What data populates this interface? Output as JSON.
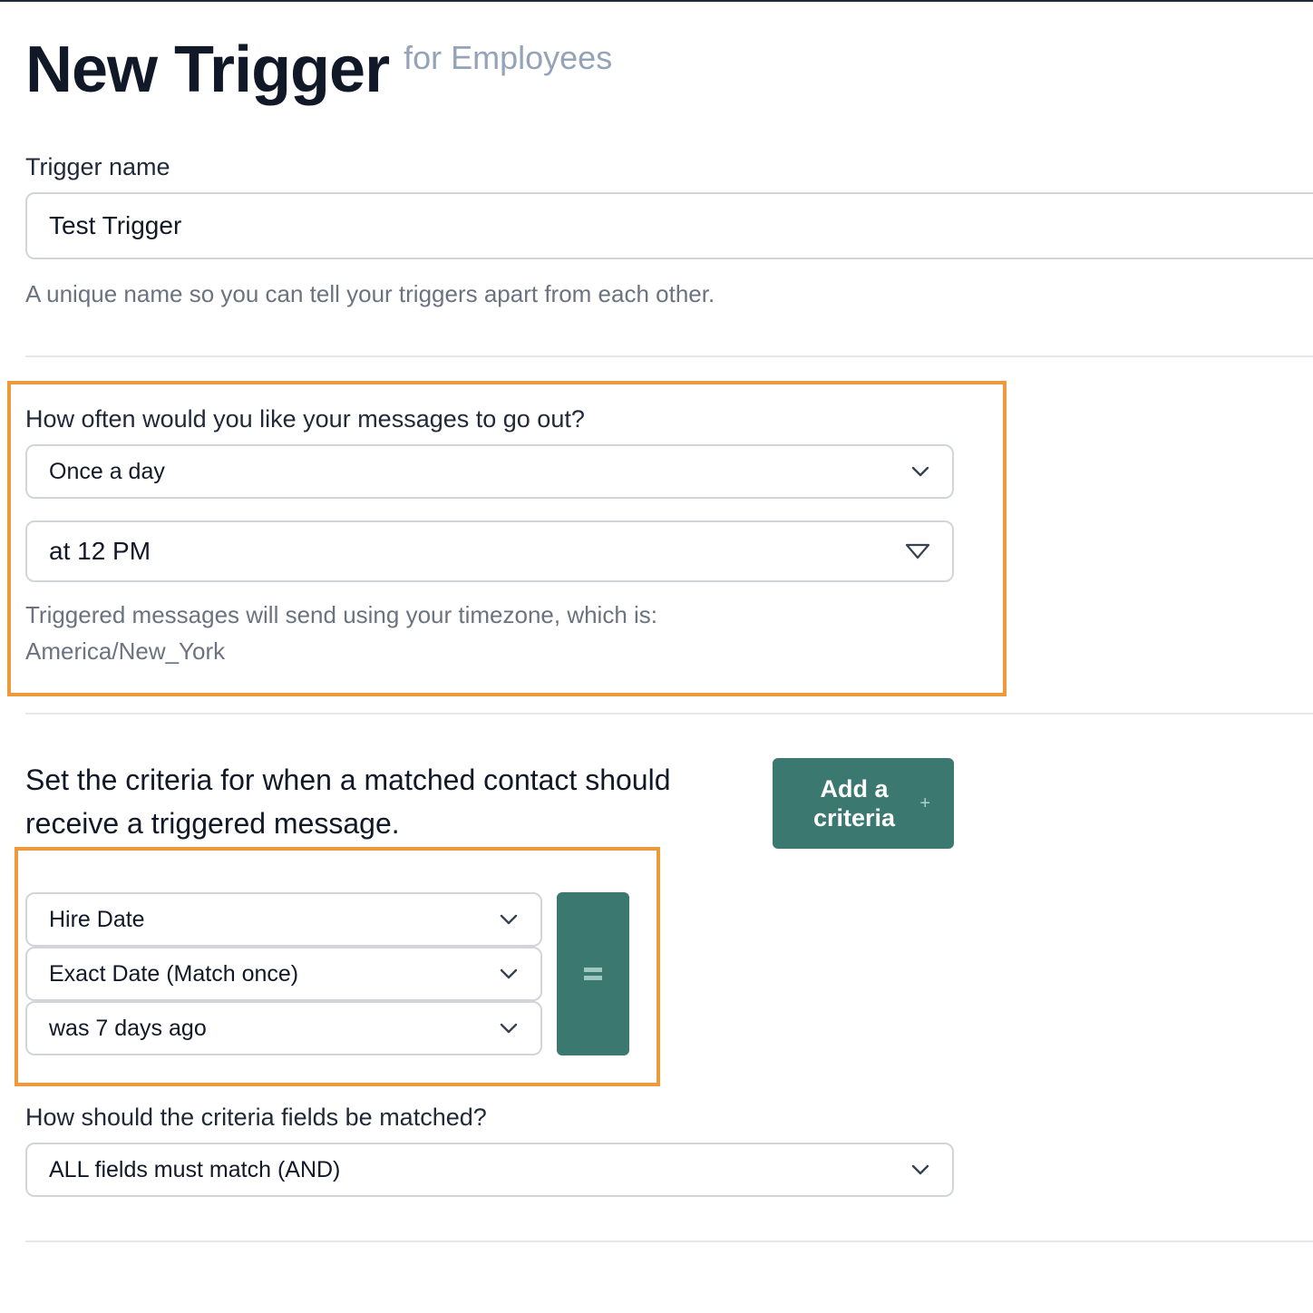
{
  "header": {
    "title": "New Trigger",
    "subtitle": "for Employees"
  },
  "trigger_name": {
    "label": "Trigger name",
    "value": "Test Trigger",
    "help": "A unique name so you can tell your triggers apart from each other."
  },
  "frequency": {
    "question": "How often would you like your messages to go out?",
    "interval_selected": "Once a day",
    "time_selected": "at 12 PM",
    "timezone_note": "Triggered messages will send using your timezone, which is:",
    "timezone": "America/New_York"
  },
  "criteria": {
    "heading": "Set the criteria for when a matched contact should receive a triggered message.",
    "add_button_label": "Add a criteria",
    "add_button_icon": "plus-icon",
    "remove_button_icon": "minus-icon",
    "rows": [
      {
        "field": "Hire Date",
        "condition": "Exact Date (Match once)",
        "value": "was 7 days ago"
      }
    ],
    "match_question": "How should the criteria fields be matched?",
    "match_selected": "ALL fields must match (AND)"
  },
  "colors": {
    "accent": "#3a7870",
    "highlight": "#ef9a3a",
    "title": "#111827",
    "subtitle": "#94a3b8"
  }
}
